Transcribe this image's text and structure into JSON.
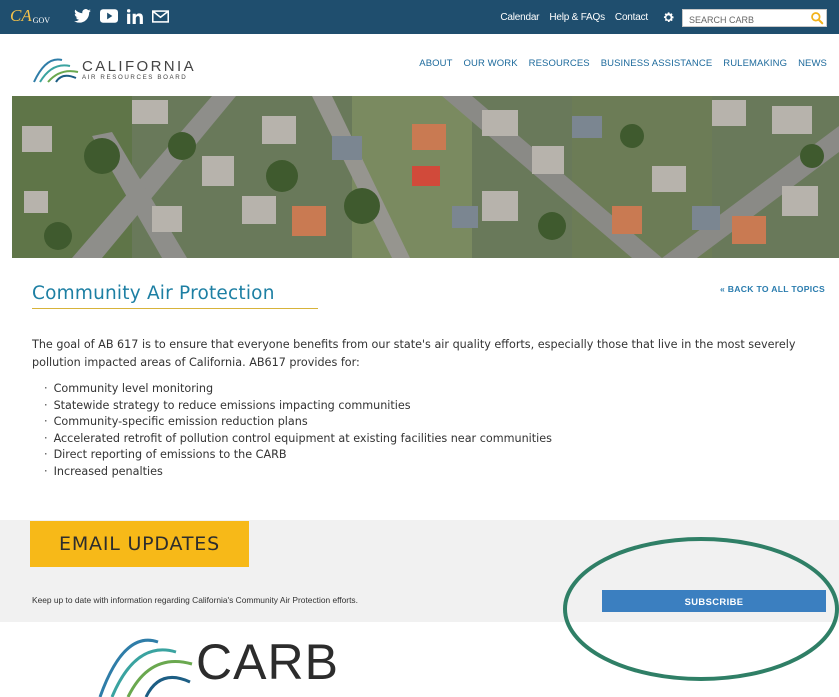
{
  "topbar": {
    "cagov": "CA",
    "cagov_suffix": "GOV",
    "links": [
      "Calendar",
      "Help & FAQs",
      "Contact"
    ],
    "search_placeholder": "SEARCH CARB",
    "colors": {
      "bar": "#1f4e6e",
      "cagov": "#f6c34a"
    },
    "icons": [
      "twitter-icon",
      "youtube-icon",
      "linkedin-icon",
      "email-icon",
      "gear-icon",
      "search-icon"
    ]
  },
  "header": {
    "logo_wordmark": "CALIFORNIA",
    "logo_subtitle": "AIR RESOURCES BOARD",
    "nav": [
      "ABOUT",
      "OUR WORK",
      "RESOURCES",
      "BUSINESS ASSISTANCE",
      "RULEMAKING",
      "NEWS"
    ]
  },
  "main": {
    "title": "Community Air Protection",
    "back_link": "« BACK TO ALL TOPICS",
    "intro": "The goal of AB 617 is to ensure that everyone benefits from our state's air quality efforts, especially those that live in the most severely pollution impacted areas of California. AB617 provides for:",
    "bullets": [
      "Community level monitoring",
      "Statewide strategy to reduce emissions impacting communities",
      "Community-specific emission reduction plans",
      "Accelerated retrofit of pollution control equipment at existing facilities near  communities",
      "Direct reporting of emissions to the CARB",
      "Increased penalties"
    ]
  },
  "email": {
    "heading": "EMAIL UPDATES",
    "text": "Keep up to date with information regarding California's Community Air Protection efforts.",
    "subscribe_label": "SUBSCRIBE",
    "colors": {
      "heading_bg": "#f7b918",
      "subscribe_bg": "#3b7fc0",
      "highlight_ring": "#2f7f66"
    }
  },
  "footer": {
    "logo_text": "CARB"
  }
}
